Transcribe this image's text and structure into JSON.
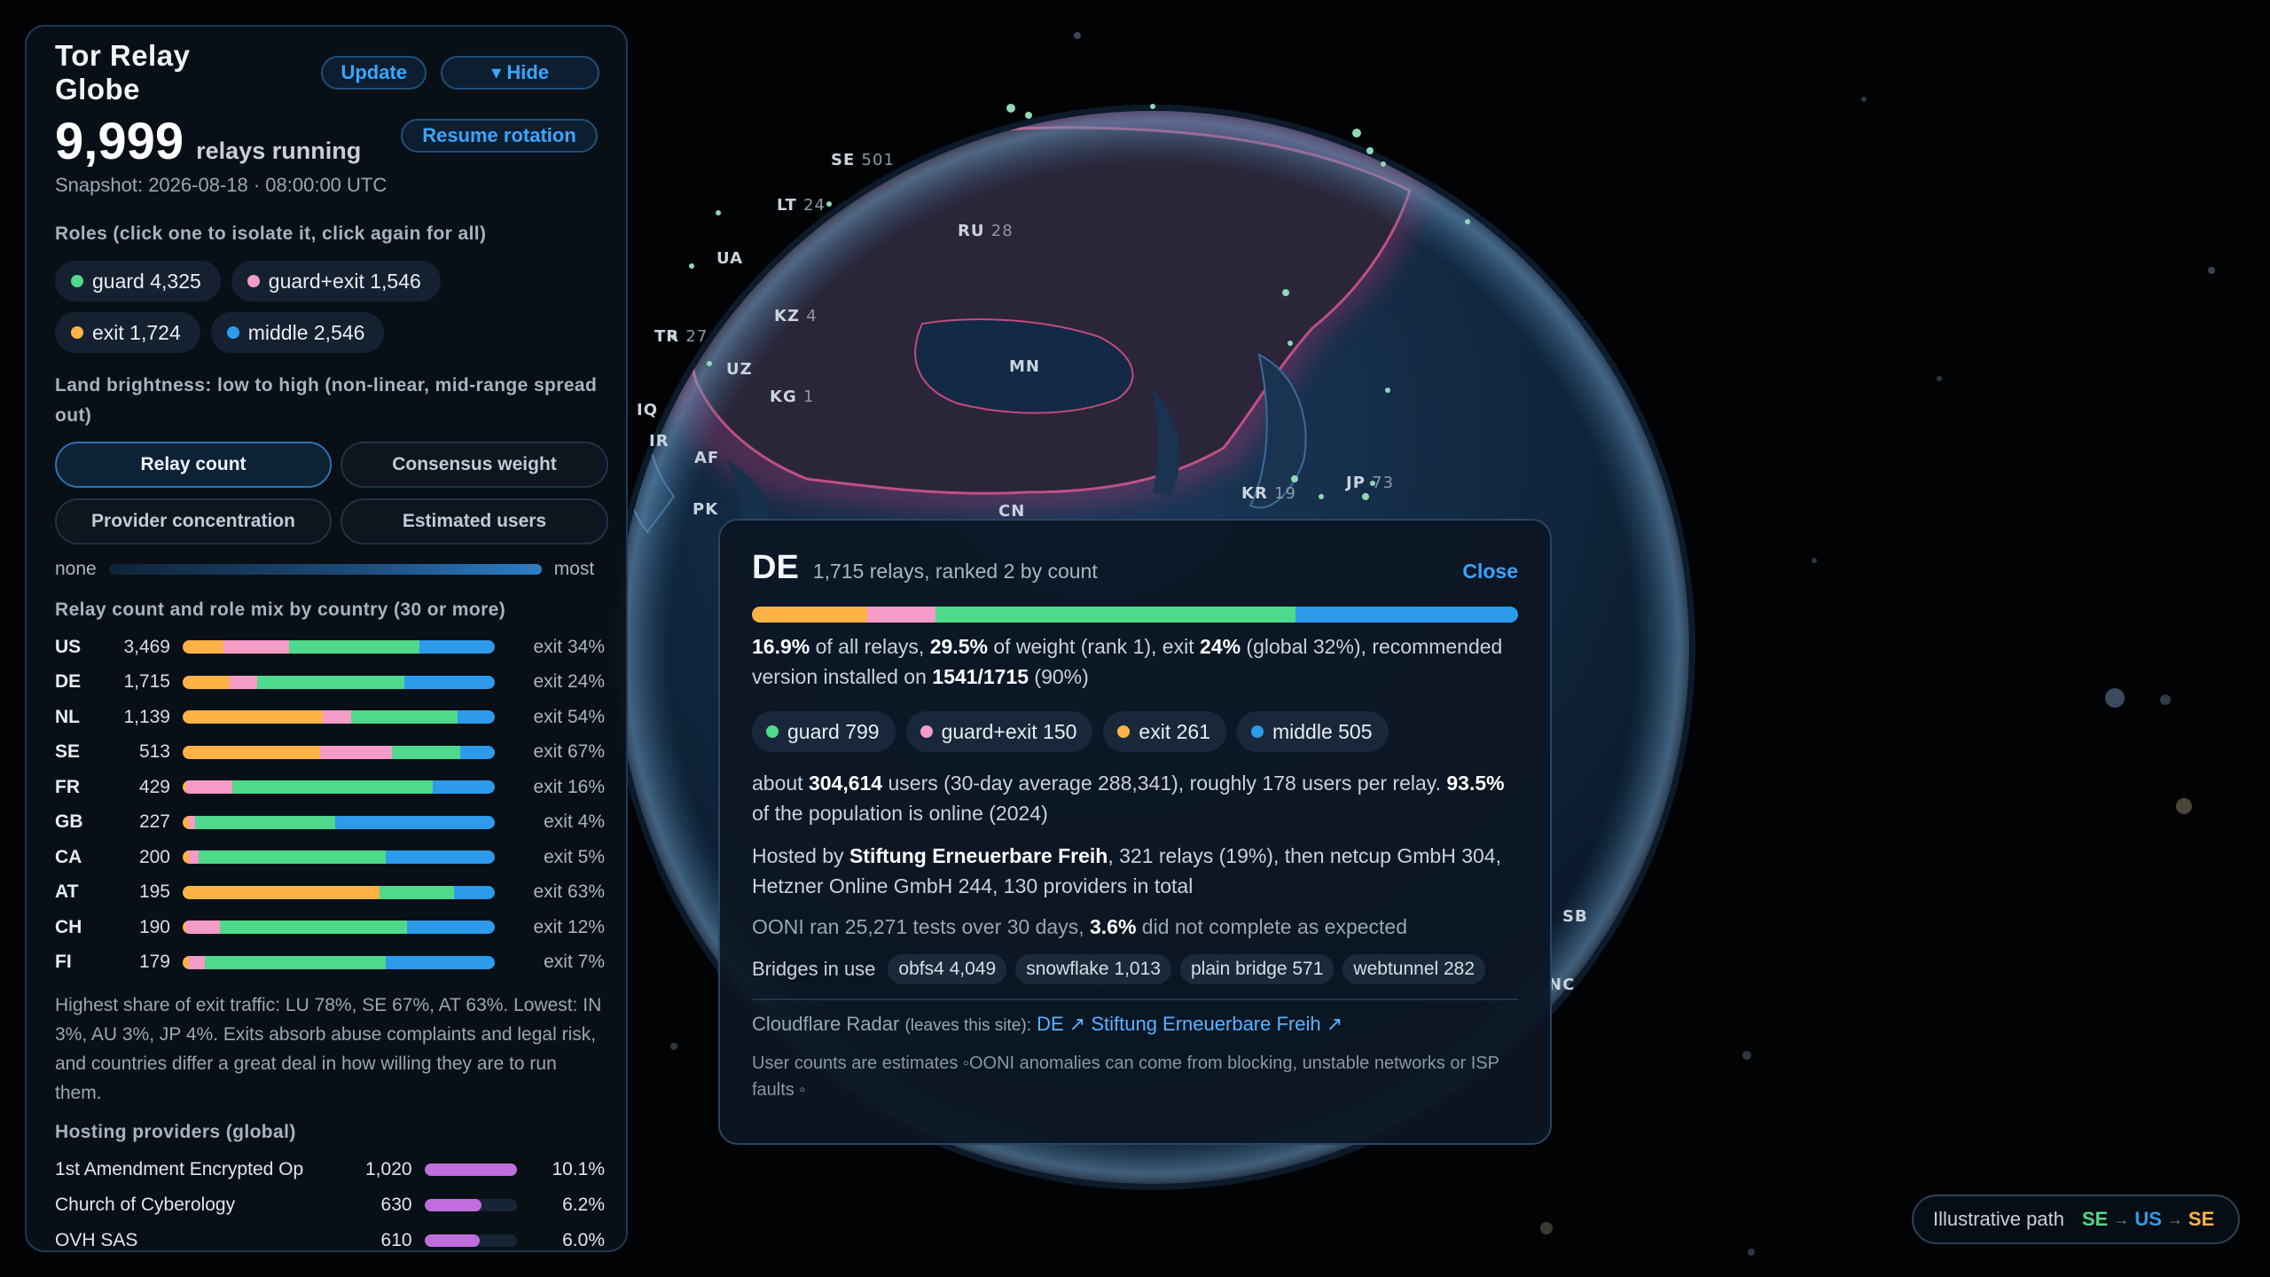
{
  "app": {
    "title": "Tor Relay Globe",
    "update_label": "Update",
    "hide_label": "▾ Hide",
    "relay_count": "9,999",
    "relay_count_label": "relays running",
    "resume_label": "Resume rotation",
    "snapshot": "Snapshot: 2026-08-18 · 08:00:00 UTC"
  },
  "colors": {
    "guard": "#4fd98a",
    "guard_exit": "#f59bc8",
    "exit": "#ffb347",
    "middle": "#2d9bea",
    "provider_bar": "#bf6fdc",
    "accent": "#38a3ff"
  },
  "roles": {
    "heading": "Roles (click one to isolate it, click again for all)",
    "items": [
      {
        "label": "guard 4,325",
        "color": "#4fd98a"
      },
      {
        "label": "guard+exit 1,546",
        "color": "#f59bc8"
      },
      {
        "label": "exit 1,724",
        "color": "#ffb347"
      },
      {
        "label": "middle 2,546",
        "color": "#2d9bea"
      }
    ]
  },
  "brightness": {
    "heading": "Land brightness: low to high (non-linear, mid-range spread out)",
    "modes": [
      "Relay count",
      "Consensus weight",
      "Provider concentration",
      "Estimated users"
    ],
    "active_mode": "Relay count",
    "scale_min": "none",
    "scale_max": "most"
  },
  "countries": {
    "heading": "Relay count and role mix by country (30 or more)",
    "rows": [
      {
        "cc": "US",
        "count": "3,469",
        "exit": "exit 34%",
        "mix": [
          0.13,
          0.21,
          0.42,
          0.24
        ]
      },
      {
        "cc": "DE",
        "count": "1,715",
        "exit": "exit 24%",
        "mix": [
          0.15,
          0.09,
          0.47,
          0.29
        ]
      },
      {
        "cc": "NL",
        "count": "1,139",
        "exit": "exit 54%",
        "mix": [
          0.45,
          0.09,
          0.34,
          0.12
        ]
      },
      {
        "cc": "SE",
        "count": "513",
        "exit": "exit 67%",
        "mix": [
          0.44,
          0.23,
          0.22,
          0.11
        ]
      },
      {
        "cc": "FR",
        "count": "429",
        "exit": "exit 16%",
        "mix": [
          0.01,
          0.15,
          0.64,
          0.2
        ]
      },
      {
        "cc": "GB",
        "count": "227",
        "exit": "exit 4%",
        "mix": [
          0.02,
          0.02,
          0.45,
          0.51
        ]
      },
      {
        "cc": "CA",
        "count": "200",
        "exit": "exit 5%",
        "mix": [
          0.02,
          0.03,
          0.6,
          0.35
        ]
      },
      {
        "cc": "AT",
        "count": "195",
        "exit": "exit 63%",
        "mix": [
          0.63,
          0.0,
          0.24,
          0.13
        ]
      },
      {
        "cc": "CH",
        "count": "190",
        "exit": "exit 12%",
        "mix": [
          0.01,
          0.11,
          0.6,
          0.28
        ]
      },
      {
        "cc": "FI",
        "count": "179",
        "exit": "exit 7%",
        "mix": [
          0.02,
          0.05,
          0.58,
          0.35
        ]
      }
    ],
    "note": "Highest share of exit traffic: LU 78%, SE 67%, AT 63%. Lowest: IN 3%, AU 3%, JP 4%. Exits absorb abuse complaints and legal risk, and countries differ a great deal in how willing they are to run them."
  },
  "providers": {
    "heading": "Hosting providers (global)",
    "rows": [
      {
        "name": "1st Amendment Encrypted Op",
        "count": "1,020",
        "pct": "10.1%",
        "share": 1.0
      },
      {
        "name": "Church of Cyberology",
        "count": "630",
        "pct": "6.2%",
        "share": 0.62
      },
      {
        "name": "OVH SAS",
        "count": "610",
        "pct": "6.0%",
        "share": 0.6
      }
    ]
  },
  "globe": {
    "labels": [
      {
        "code": "SE",
        "num": "501"
      },
      {
        "code": "LT",
        "num": "24"
      },
      {
        "code": "RU",
        "num": "28"
      },
      {
        "code": "UA",
        "num": ""
      },
      {
        "code": "KZ",
        "num": "4"
      },
      {
        "code": "TR",
        "num": "27"
      },
      {
        "code": "UZ",
        "num": ""
      },
      {
        "code": "KG",
        "num": "1"
      },
      {
        "code": "MN",
        "num": ""
      },
      {
        "code": "IQ",
        "num": ""
      },
      {
        "code": "IR",
        "num": ""
      },
      {
        "code": "AF",
        "num": ""
      },
      {
        "code": "PK",
        "num": ""
      },
      {
        "code": "CN",
        "num": ""
      },
      {
        "code": "KR",
        "num": "19"
      },
      {
        "code": "JP",
        "num": "73"
      },
      {
        "code": "SB",
        "num": ""
      },
      {
        "code": "NC",
        "num": ""
      }
    ]
  },
  "card": {
    "cc": "DE",
    "subtitle": "1,715 relays, ranked 2 by count",
    "close_label": "Close",
    "mix": [
      0.15,
      0.09,
      0.47,
      0.29
    ],
    "share_line": {
      "p1": "16.9%",
      "t1": " of all relays, ",
      "p2": "29.5%",
      "t2": " of weight (rank 1), exit ",
      "p3": "24%",
      "t3": " (global 32%), recommended version installed on ",
      "p4": "1541/1715",
      "t4": " (90%)"
    },
    "chips": [
      {
        "label": "guard 799",
        "color": "#4fd98a"
      },
      {
        "label": "guard+exit 150",
        "color": "#f59bc8"
      },
      {
        "label": "exit 261",
        "color": "#ffb347"
      },
      {
        "label": "middle 505",
        "color": "#2d9bea"
      }
    ],
    "users_line": {
      "t0": "about ",
      "p1": "304,614",
      "t1": " users (30-day average 288,341), roughly 178 users per relay. ",
      "p2": "93.5%",
      "t2": " of the population is online (2024)"
    },
    "hosting_line": {
      "t0": "Hosted by ",
      "p1": "Stiftung Erneuerbare Freih",
      "t1": ", 321 relays (19%), then netcup GmbH 304, Hetzner Online GmbH 244, 130 providers in total"
    },
    "ooni_line": {
      "t0": "OONI ran 25,271 tests over 30 days, ",
      "p1": "3.6%",
      "t1": " did not complete as expected"
    },
    "bridges_label": "Bridges in use",
    "bridges": [
      "obfs4 4,049",
      "snowflake 1,013",
      "plain bridge 571",
      "webtunnel 282"
    ],
    "radar": {
      "label": "Cloudflare Radar",
      "sub": "(leaves this site):",
      "link1": "DE ↗",
      "link2": "Stiftung Erneuerbare Freih ↗"
    },
    "footnote": "User counts are estimates ◦OONI anomalies can come from blocking, unstable networks or ISP faults ◦"
  },
  "path": {
    "label": "Illustrative path",
    "hops": [
      "SE",
      "US",
      "SE"
    ],
    "arrow": "→"
  }
}
